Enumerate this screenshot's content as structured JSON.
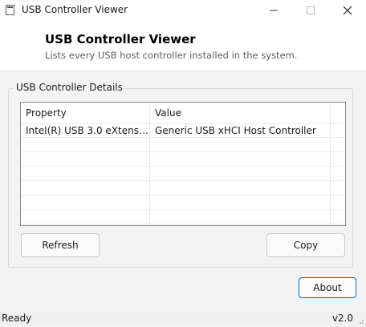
{
  "window": {
    "title": "USB Controller Viewer",
    "icon": "app-window-icon"
  },
  "header": {
    "title": "USB Controller Viewer",
    "subtitle": "Lists every USB host controller installed in the system."
  },
  "group": {
    "label": "USB Controller Details"
  },
  "table": {
    "columns": [
      "Property",
      "Value"
    ],
    "rows": [
      {
        "property": "Intel(R) USB 3.0 eXtensible ...",
        "value": "Generic USB xHCI Host Controller"
      }
    ]
  },
  "buttons": {
    "refresh": "Refresh",
    "copy": "Copy",
    "about": "About"
  },
  "status": {
    "text": "Ready",
    "version": "v2.0"
  },
  "colors": {
    "accent": "#0067c0",
    "window_bg": "#f3f3f3",
    "header_bg": "#ffffff"
  }
}
